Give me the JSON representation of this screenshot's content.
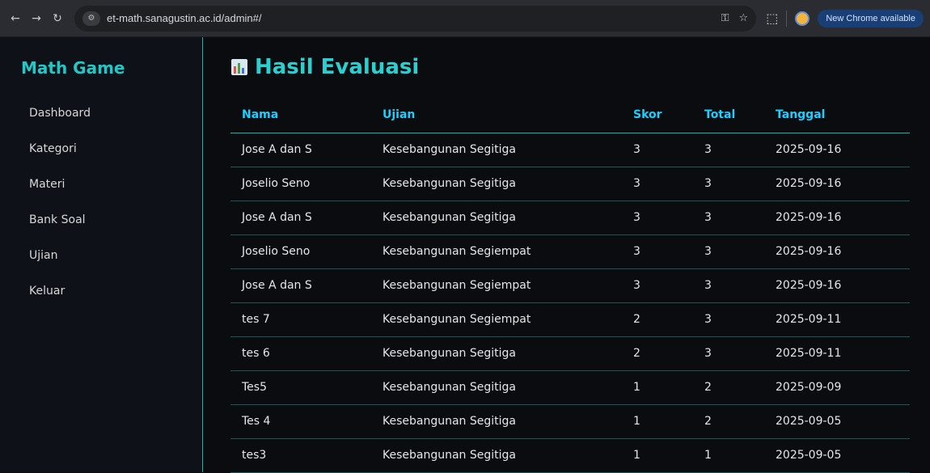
{
  "browser": {
    "url": "et-math.sanagustin.ac.id/admin#/",
    "update_label": "New Chrome available"
  },
  "sidebar": {
    "brand": "Math Game",
    "items": [
      {
        "label": "Dashboard"
      },
      {
        "label": "Kategori"
      },
      {
        "label": "Materi"
      },
      {
        "label": "Bank Soal"
      },
      {
        "label": "Ujian"
      },
      {
        "label": "Keluar"
      }
    ]
  },
  "main": {
    "title": "Hasil Evaluasi",
    "columns": [
      "Nama",
      "Ujian",
      "Skor",
      "Total",
      "Tanggal"
    ],
    "rows": [
      [
        "Jose A dan S",
        "Kesebangunan Segitiga",
        "3",
        "3",
        "2025-09-16"
      ],
      [
        "Joselio Seno",
        "Kesebangunan Segitiga",
        "3",
        "3",
        "2025-09-16"
      ],
      [
        "Jose A dan S",
        "Kesebangunan Segitiga",
        "3",
        "3",
        "2025-09-16"
      ],
      [
        "Joselio Seno",
        "Kesebangunan Segiempat",
        "3",
        "3",
        "2025-09-16"
      ],
      [
        "Jose A dan S",
        "Kesebangunan Segiempat",
        "3",
        "3",
        "2025-09-16"
      ],
      [
        "tes 7",
        "Kesebangunan Segiempat",
        "2",
        "3",
        "2025-09-11"
      ],
      [
        "tes 6",
        "Kesebangunan Segitiga",
        "2",
        "3",
        "2025-09-11"
      ],
      [
        "Tes5",
        "Kesebangunan Segitiga",
        "1",
        "2",
        "2025-09-09"
      ],
      [
        "Tes 4",
        "Kesebangunan Segitiga",
        "1",
        "2",
        "2025-09-05"
      ],
      [
        "tes3",
        "Kesebangunan Segitiga",
        "1",
        "1",
        "2025-09-05"
      ]
    ]
  }
}
